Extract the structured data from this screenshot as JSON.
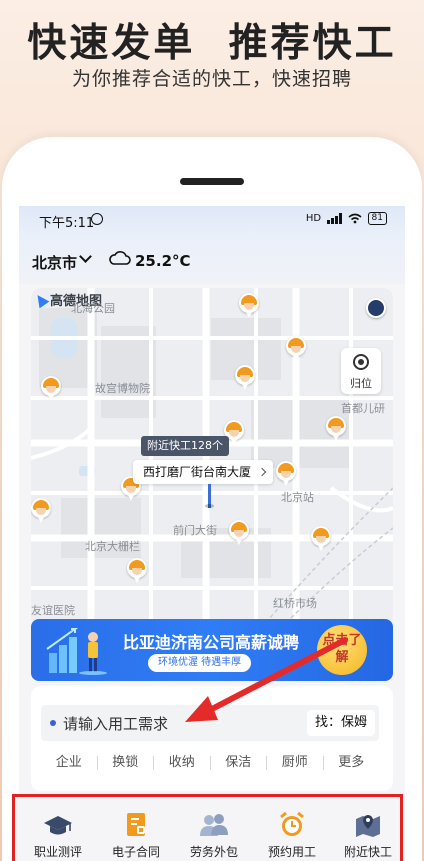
{
  "promo": {
    "headline": "快速发单  推荐快工",
    "subline": "为你推荐合适的快工，快速招聘"
  },
  "status": {
    "time": "下午5:11",
    "network": "HD",
    "battery": "81"
  },
  "location": {
    "city": "北京市",
    "temperature": "25.2°C"
  },
  "map": {
    "provider": "高德地图",
    "labels": {
      "beihai": "北海公园",
      "gugong": "故宫博物院",
      "shoudu": "首都儿研",
      "beijing_station": "北京站",
      "qianmen": "前门大街",
      "dashilan": "北京大栅栏",
      "youyi": "友谊医院",
      "hongqiao": "红桥市场"
    },
    "locate_label": "归位",
    "nearby_tag": "附近快工128个",
    "address": "西打磨厂街台南大厦"
  },
  "banner": {
    "title": "比亚迪济南公司高薪诚聘",
    "subtitle": "环境优渥  待遇丰厚",
    "cta": "点击了解"
  },
  "search": {
    "placeholder": "请输入用工需求",
    "find_button": "找：保姆"
  },
  "categories": [
    "企业",
    "换锁",
    "收纳",
    "保洁",
    "厨师",
    "更多"
  ],
  "tabs": [
    {
      "label": "职业测评",
      "icon": "graduation-cap-icon"
    },
    {
      "label": "电子合同",
      "icon": "contract-icon"
    },
    {
      "label": "劳务外包",
      "icon": "people-icon"
    },
    {
      "label": "预约用工",
      "icon": "alarm-clock-icon"
    },
    {
      "label": "附近快工",
      "icon": "map-pin-icon"
    }
  ],
  "colors": {
    "accent": "#2f7df6",
    "worker_helmet": "#f29a1e",
    "highlight_border": "#e12222",
    "annotation_arrow": "#e52a2a"
  }
}
